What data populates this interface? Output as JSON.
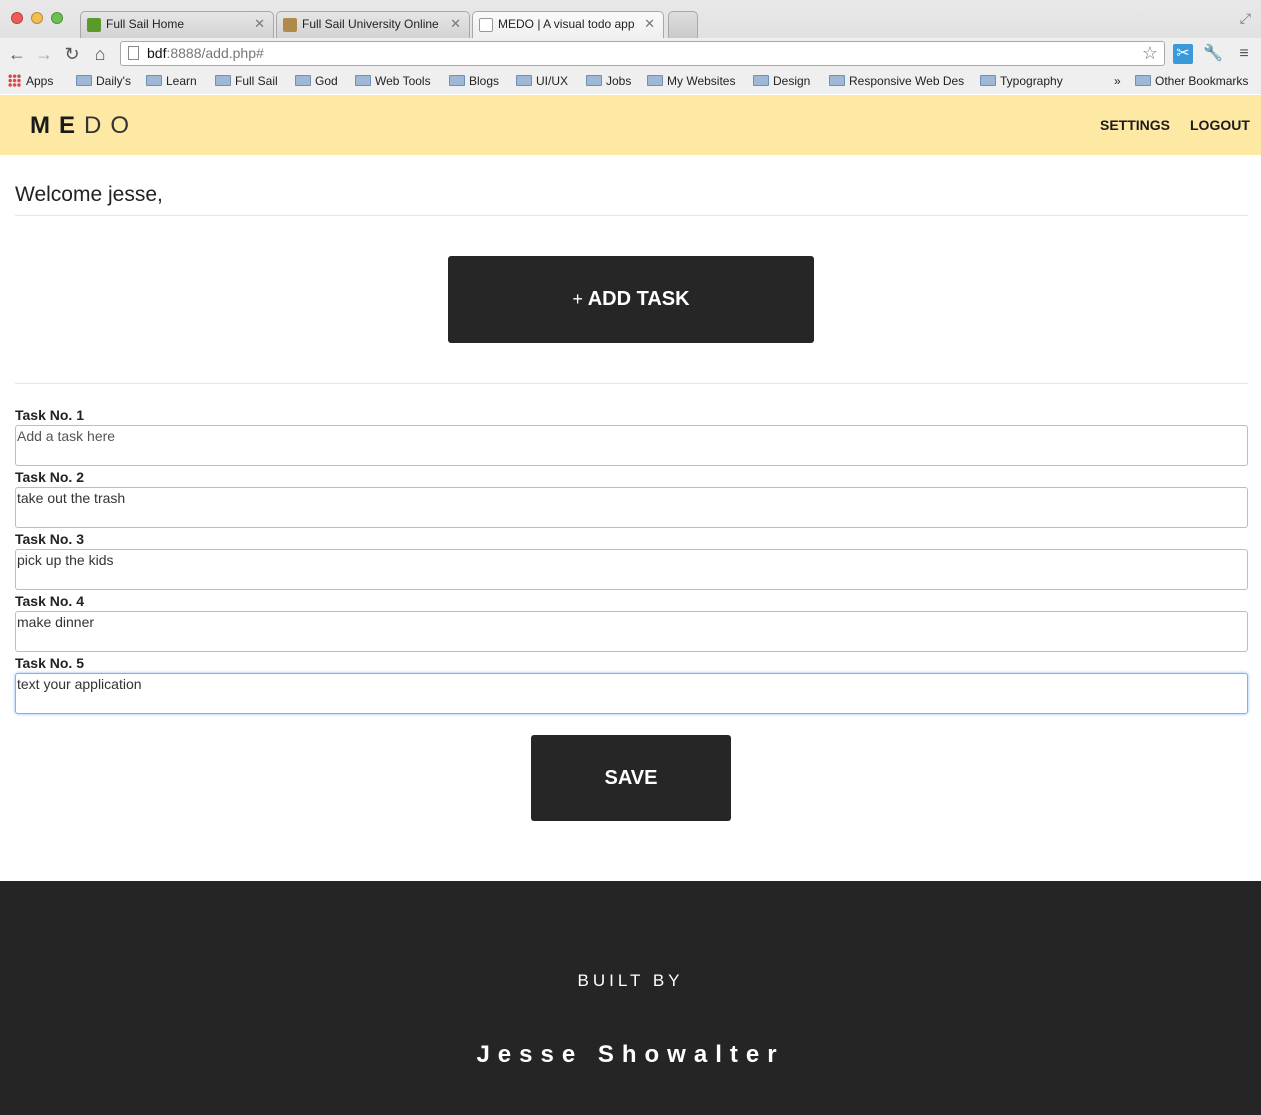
{
  "browser": {
    "tabs": [
      {
        "title": "Full Sail Home",
        "favicon_color": "#5a9a2a"
      },
      {
        "title": "Full Sail University Online",
        "favicon_color": "#b08a4a"
      },
      {
        "title": "MEDO | A visual todo app",
        "favicon_color": "#ffffff"
      }
    ],
    "url_host": "bdf",
    "url_path": ":8888/add.php#",
    "bookmarks": {
      "apps": "Apps",
      "items": [
        "Daily's",
        "Learn",
        "Full Sail",
        "God",
        "Web Tools",
        "Blogs",
        "UI/UX",
        "Jobs",
        "My Websites",
        "Design",
        "Responsive Web Des",
        "Typography"
      ],
      "overflow": "»",
      "other": "Other Bookmarks"
    }
  },
  "header": {
    "logo_bold": "ME",
    "logo_light": "DO",
    "nav": [
      "SETTINGS",
      "LOGOUT"
    ],
    "background": "#fde9a4"
  },
  "main": {
    "welcome": "Welcome jesse,",
    "add_button": {
      "plus": "+",
      "label": "ADD TASK"
    },
    "tasks": [
      {
        "label": "Task No. 1",
        "value": "",
        "placeholder": "Add a task here"
      },
      {
        "label": "Task No. 2",
        "value": "take out the trash",
        "placeholder": ""
      },
      {
        "label": "Task No. 3",
        "value": "pick up the kids",
        "placeholder": ""
      },
      {
        "label": "Task No. 4",
        "value": "make dinner",
        "placeholder": ""
      },
      {
        "label": "Task No. 5",
        "value": "text your application",
        "placeholder": ""
      }
    ],
    "save_label": "SAVE"
  },
  "footer": {
    "built_by": "BUILT BY",
    "author": "Jesse Showalter",
    "background": "#252525"
  }
}
